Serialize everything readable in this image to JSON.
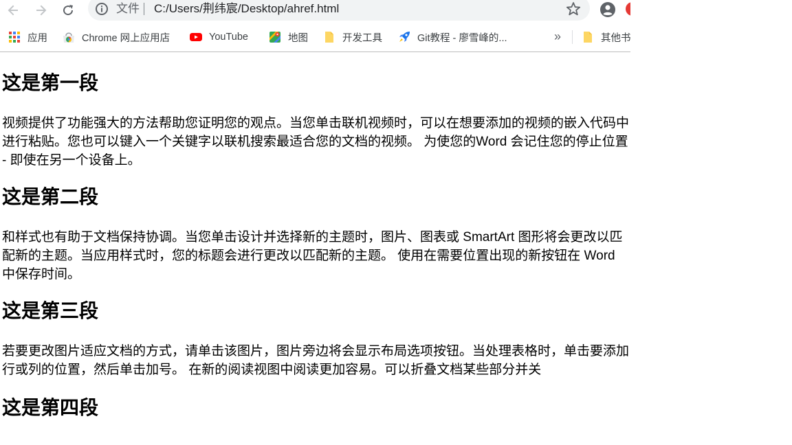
{
  "toolbar": {
    "scheme_label": "文件",
    "url": "C:/Users/荆纬宸/Desktop/ahref.html"
  },
  "bookmarks": {
    "items": [
      {
        "label": "应用",
        "icon": "apps-grid-icon"
      },
      {
        "label": "Chrome 网上应用店",
        "icon": "chrome-webstore-icon"
      },
      {
        "label": "YouTube",
        "icon": "youtube-icon"
      },
      {
        "label": "地图",
        "icon": "maps-icon"
      },
      {
        "label": "开发工具",
        "icon": "folder-icon"
      },
      {
        "label": "Git教程 - 廖雪峰的...",
        "icon": "rocket-icon"
      },
      {
        "label": "其他书",
        "icon": "folder-icon"
      }
    ],
    "more_label": "»"
  },
  "content": {
    "sections": [
      {
        "heading": "这是第一段",
        "text": "视频提供了功能强大的方法帮助您证明您的观点。当您单击联机视频时，可以在想要添加的视频的嵌入代码中进行粘贴。您也可以键入一个关键字以联机搜索最适合您的文档的视频。 为使您的Word 会记住您的停止位置 - 即使在另一个设备上。"
      },
      {
        "heading": "这是第二段",
        "text": "和样式也有助于文档保持协调。当您单击设计并选择新的主题时，图片、图表或 SmartArt 图形将会更改以匹配新的主题。当应用样式时，您的标题会进行更改以匹配新的主题。 使用在需要位置出现的新按钮在 Word 中保存时间。"
      },
      {
        "heading": "这是第三段",
        "text": "若要更改图片适应文档的方式，请单击该图片，图片旁边将会显示布局选项按钮。当处理表格时，单击要添加行或列的位置，然后单击加号。 在新的阅读视图中阅读更加容易。可以折叠文档某些部分并关"
      },
      {
        "heading": "这是第四段"
      }
    ]
  },
  "colors": {
    "omnibox_bg": "#f1f3f4",
    "icon_gray": "#5f6368",
    "youtube_red": "#ff0000",
    "folder_yellow": "#fdd663"
  }
}
